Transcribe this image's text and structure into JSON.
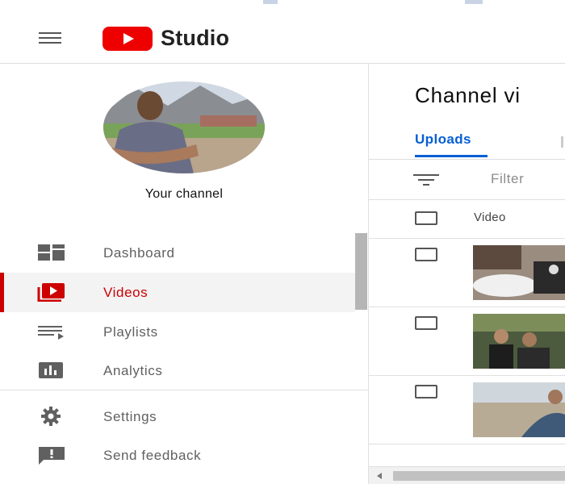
{
  "header": {
    "menu_icon": "hamburger-menu-icon",
    "logo_icon": "youtube-play-logo-icon",
    "brand": "Studio"
  },
  "sidebar": {
    "channel_label": "Your channel",
    "items": [
      {
        "label": "Dashboard",
        "icon": "dashboard-icon",
        "active": false
      },
      {
        "label": "Videos",
        "icon": "videos-icon",
        "active": true
      },
      {
        "label": "Playlists",
        "icon": "playlists-icon",
        "active": false
      },
      {
        "label": "Analytics",
        "icon": "analytics-icon",
        "active": false
      }
    ],
    "footer_items": [
      {
        "label": "Settings",
        "icon": "gear-icon"
      },
      {
        "label": "Send feedback",
        "icon": "feedback-icon"
      }
    ]
  },
  "main": {
    "title": "Channel vi",
    "tabs": [
      {
        "label": "Uploads",
        "active": true
      }
    ],
    "filter_placeholder": "Filter",
    "table": {
      "columns": [
        "Video"
      ],
      "rows": 3
    }
  },
  "colors": {
    "accent": "#065fd4",
    "active_nav": "#cc0000",
    "brand_red": "#ee0000"
  }
}
